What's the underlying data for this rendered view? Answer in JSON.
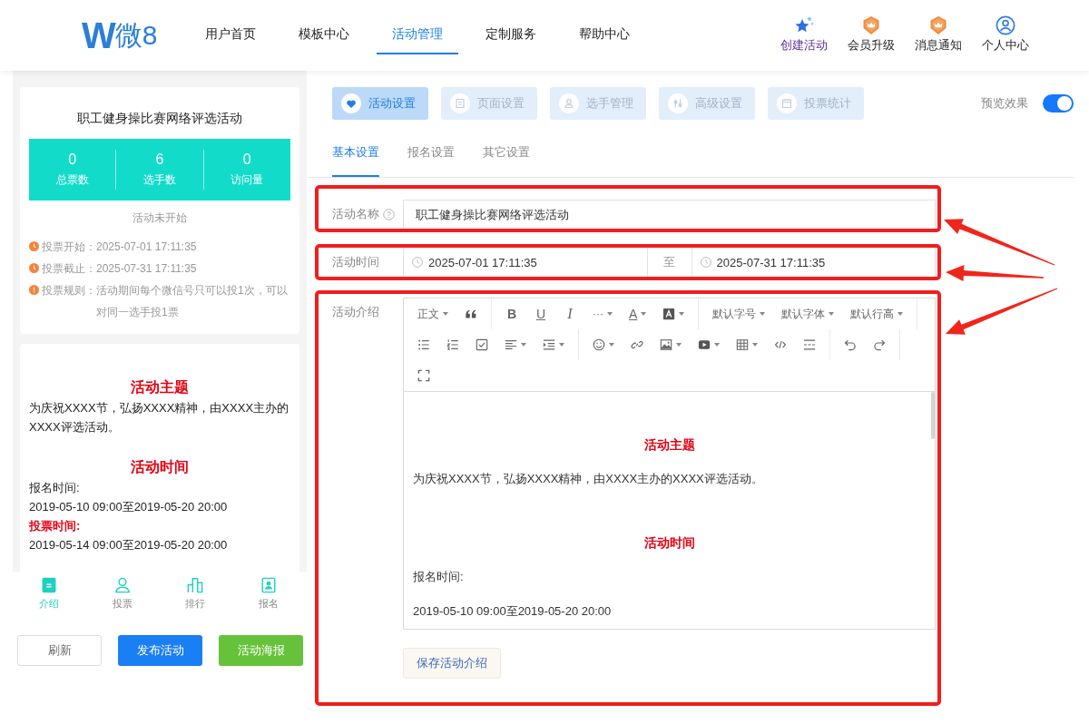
{
  "header": {
    "logo": {
      "mark": "W",
      "text": "微8"
    },
    "nav": [
      {
        "label": "用户首页",
        "selected": false
      },
      {
        "label": "模板中心",
        "selected": false
      },
      {
        "label": "活动管理",
        "selected": true
      },
      {
        "label": "定制服务",
        "selected": false
      },
      {
        "label": "帮助中心",
        "selected": false
      }
    ],
    "actions": [
      {
        "label": "创建活动",
        "kind": "featured"
      },
      {
        "label": "会员升级",
        "kind": "plain"
      },
      {
        "label": "消息通知",
        "kind": "plain"
      },
      {
        "label": "个人中心",
        "kind": "plain"
      }
    ]
  },
  "preview": {
    "title": "职工健身操比赛网络评选活动",
    "stats": [
      {
        "value": "0",
        "label": "总票数"
      },
      {
        "value": "6",
        "label": "选手数"
      },
      {
        "value": "0",
        "label": "访问量"
      }
    ],
    "status": "活动未开始",
    "info": [
      {
        "kind": "time",
        "label": "投票开始：",
        "value": "2025-07-01 17:11:35"
      },
      {
        "kind": "time",
        "label": "投票截止：",
        "value": "2025-07-31 17:11:35"
      },
      {
        "kind": "rule",
        "label": "投票规则：",
        "value": "活动期间每个微信号只可以投1次，可以对同一选手投1票"
      }
    ],
    "content": [
      {
        "kind": "heading",
        "text": "活动主题"
      },
      {
        "kind": "text",
        "text": "为庆祝XXXX节，弘扬XXXX精神，由XXXX主办的XXXX评选活动。"
      },
      {
        "kind": "heading",
        "text": "活动时间"
      },
      {
        "kind": "text",
        "text": "报名时间:"
      },
      {
        "kind": "text",
        "text": "2019-05-10 09:00至2019-05-20 20:00"
      },
      {
        "kind": "highlight",
        "text": "投票时间:"
      },
      {
        "kind": "text",
        "text": "2019-05-14 09:00至2019-05-20 20:00"
      }
    ],
    "tabs": [
      {
        "label": "介绍",
        "selected": true
      },
      {
        "label": "投票",
        "selected": false
      },
      {
        "label": "排行",
        "selected": false
      },
      {
        "label": "报名",
        "selected": false
      }
    ]
  },
  "buttons": [
    {
      "label": "刷新",
      "kind": "default"
    },
    {
      "label": "发布活动",
      "kind": "primary"
    },
    {
      "label": "活动海报",
      "kind": "success"
    }
  ],
  "settings": {
    "sections": [
      {
        "label": "活动设置",
        "selected": true
      },
      {
        "label": "页面设置",
        "selected": false
      },
      {
        "label": "选手管理",
        "selected": false
      },
      {
        "label": "高级设置",
        "selected": false
      },
      {
        "label": "投票统计",
        "selected": false
      }
    ],
    "preview_toggle": {
      "label": "预览效果",
      "on": true
    },
    "tabs": [
      {
        "label": "基本设置",
        "selected": true
      },
      {
        "label": "报名设置",
        "selected": false
      },
      {
        "label": "其它设置",
        "selected": false
      }
    ],
    "form": {
      "name": {
        "label": "活动名称",
        "value": "职工健身操比赛网络评选活动"
      },
      "time": {
        "label": "活动时间",
        "start": "2025-07-01 17:11:35",
        "separator": "至",
        "end": "2025-07-31 17:11:35"
      },
      "intro": {
        "label": "活动介绍",
        "toolbar": [
          [
            [
              {
                "kind": "text",
                "label": "正文",
                "dropdown": true
              },
              {
                "kind": "quote"
              }
            ],
            [
              {
                "kind": "bold",
                "label": "B"
              },
              {
                "kind": "underline",
                "label": "U"
              },
              {
                "kind": "italic",
                "label": "I"
              },
              {
                "kind": "text",
                "label": "···",
                "dropdown": true
              },
              {
                "kind": "color",
                "label": "A",
                "dropdown": true
              },
              {
                "kind": "background",
                "dropdown": true
              }
            ],
            [
              {
                "kind": "text",
                "label": "默认字号",
                "dropdown": true
              },
              {
                "kind": "text",
                "label": "默认字体",
                "dropdown": true
              },
              {
                "kind": "text",
                "label": "默认行高",
                "dropdown": true
              }
            ]
          ],
          [
            [
              {
                "kind": "bullets"
              },
              {
                "kind": "numbers"
              },
              {
                "kind": "todo"
              },
              {
                "kind": "align",
                "dropdown": true
              },
              {
                "kind": "indent",
                "dropdown": true
              }
            ],
            [
              {
                "kind": "emoji",
                "dropdown": true
              },
              {
                "kind": "link"
              },
              {
                "kind": "image",
                "dropdown": true
              },
              {
                "kind": "video",
                "dropdown": true
              },
              {
                "kind": "table",
                "dropdown": true
              },
              {
                "kind": "code"
              },
              {
                "kind": "divider"
              }
            ],
            [
              {
                "kind": "undo"
              },
              {
                "kind": "redo"
              }
            ]
          ],
          [
            [
              {
                "kind": "fullscreen"
              }
            ]
          ]
        ],
        "content": [
          {
            "kind": "heading",
            "text": "活动主题"
          },
          {
            "kind": "text",
            "text": "为庆祝XXXX节，弘扬XXXX精神，由XXXX主办的XXXX评选活动。"
          },
          {
            "kind": "heading",
            "text": "活动时间"
          },
          {
            "kind": "text",
            "text": "报名时间:"
          },
          {
            "kind": "text",
            "text": "2019-05-10 09:00至2019-05-20 20:00"
          }
        ],
        "save": "保存活动介绍"
      }
    }
  }
}
